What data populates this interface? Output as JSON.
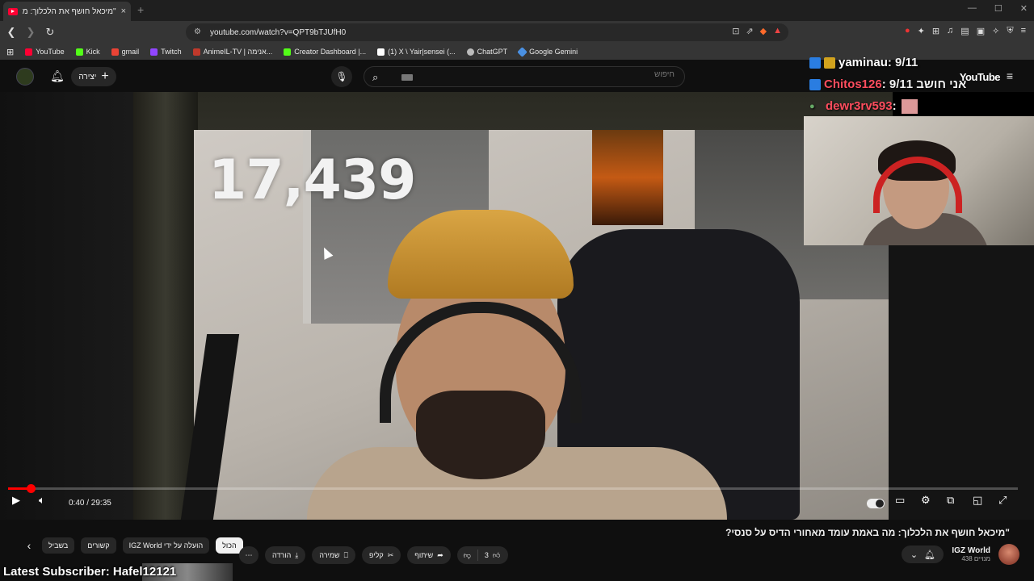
{
  "browser": {
    "tab_title": "\"מיכאל חושף את הלכלוך: מה באמ",
    "tab_close": "×",
    "new_tab": "+",
    "url": "youtube.com/watch?v=QPT9bTJUfH0",
    "window_controls": [
      "—",
      "☐",
      "✕"
    ]
  },
  "bookmarks": [
    {
      "label": "YouTube",
      "color": "#ff0033"
    },
    {
      "label": "Kick",
      "color": "#53fc18"
    },
    {
      "label": "gmail",
      "color": "#ea4335"
    },
    {
      "label": "Twitch",
      "color": "#9146ff"
    },
    {
      "label": "AnimeIL-TV | אנימה...",
      "color": "#c0392b"
    },
    {
      "label": "Creator Dashboard |...",
      "color": "#53fc18"
    },
    {
      "label": "(1) X \\ Yair|sensei (...",
      "color": "#ffffff"
    },
    {
      "label": "ChatGPT",
      "color": "#bbbbbb"
    },
    {
      "label": "Google Gemini",
      "color": "#4a90e2"
    }
  ],
  "youtube": {
    "create_label": "יצירה",
    "search_placeholder": "חיפוש",
    "logo_text": "YouTube"
  },
  "video": {
    "counter_text": "17,439",
    "timecode": "0:40 / 29:35",
    "progress_fraction": 0.0225,
    "title": "\"מיכאל חושף את הלכלוך: מה באמת עומד מאחורי הדיס על סנסי?"
  },
  "overlay": {
    "chat": [
      {
        "user": "yaminau",
        "text": " : 9/11",
        "color": "#ffffff",
        "badge": "badge2"
      },
      {
        "user": "Chitos126",
        "text": " : אני חושב 9/11",
        "color": "#ff4d5e",
        "badge": "badge"
      },
      {
        "user": "dewr3rv593",
        "text": " :",
        "color": "#ff4d5e",
        "badge": "badge2"
      }
    ],
    "latest_subscriber": "Latest Subscriber: Hafel12121"
  },
  "below": {
    "chips": [
      "בשביל",
      "קשורים",
      "IGZ World הועלה על ידי",
      "הכול"
    ],
    "actions": {
      "download": "הורדה",
      "save": "שמירה",
      "clip": "קליפ",
      "share": "שיתוף",
      "like_count": "3"
    },
    "channel": {
      "name": "IGZ World",
      "subs": "438 מנויים"
    }
  }
}
